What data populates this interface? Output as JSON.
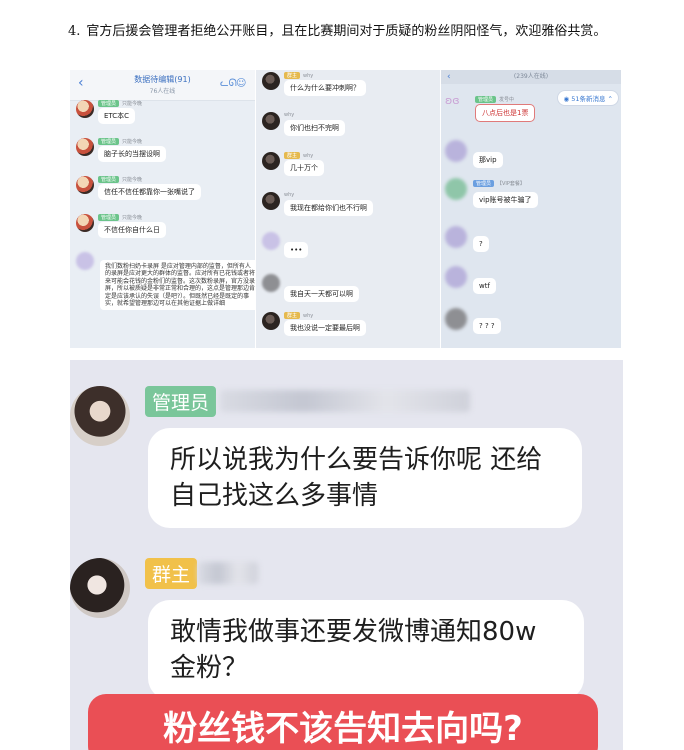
{
  "paragraph": {
    "number": "4.",
    "text": "官方后援会管理者拒绝公开账目，且在比赛期间对于质疑的粉丝阴阳怪气，欢迎雅俗共赏。"
  },
  "panel1": {
    "title": "数据待编辑(91)",
    "subtitle": "76人在线",
    "back_icon": "‹",
    "messages": [
      {
        "tag": "管理员",
        "name": "只能今晚",
        "text": "ETC本C"
      },
      {
        "tag": "管理员",
        "name": "只能今晚",
        "text": "脑子长的当摆设啊"
      },
      {
        "tag": "管理员",
        "name": "只能今晚",
        "text": "信任不信任都靠你一张嘴说了"
      },
      {
        "tag": "管理员",
        "name": "只能今晚",
        "text": "不信任你自什么日"
      }
    ],
    "long_text": "我们数粉扫奶卡录屏 是应对管理内部的监督，但所有人的录屏是应对更大的群体的监督。应对所有已花钱或者将来可能会花钱的金粉们的监督。这次数粉录屏，官方没录屏，所以被质疑是非常正常和合理的，这点是管理那边肯定是应该承认的失误（是吧?）。但既然已经是既定的事实，就希望管理那边可以在其他证据上做详细"
  },
  "panel2": {
    "messages": [
      {
        "tag": "群主",
        "name": "why",
        "text": "什么为什么要冲刺啊？"
      },
      {
        "tag": "",
        "name": "why",
        "text": "你们也扫不完啊"
      },
      {
        "tag": "群主",
        "name": "why",
        "text": "几十万个"
      },
      {
        "tag": "",
        "name": "why",
        "text": "我现在都给你们也不行啊"
      },
      {
        "tag": "",
        "name": "",
        "text": "•••"
      },
      {
        "tag": "",
        "name": "",
        "text": "我自天一天都可以啊"
      },
      {
        "tag": "群主",
        "name": "why",
        "text": "我也没说一定要最后啊"
      }
    ]
  },
  "panel3": {
    "header": "(239人在线)",
    "new_messages": "51条新消息",
    "messages": [
      {
        "tag": "管理员",
        "name": "发号中",
        "text": "八点后也是1票"
      },
      {
        "tag": "",
        "name": "",
        "text": "那vip"
      },
      {
        "tag": "管理员",
        "name": "【VIP套餐】",
        "text": "vip账号被牛骗了"
      },
      {
        "tag": "",
        "name": "",
        "text": "?"
      },
      {
        "tag": "",
        "name": "",
        "text": "wtf"
      },
      {
        "tag": "",
        "name": "",
        "text": "? ? ?"
      }
    ]
  },
  "big_chat": {
    "msg1": {
      "tag": "管理员",
      "text_line1": "所以说我为什么要告诉你呢 还给",
      "text_line2": "自己找这么多事情"
    },
    "msg2": {
      "tag": "群主",
      "text_line1": "敢情我做事还要发微博通知80w",
      "text_line2": "金粉？"
    },
    "caption": "粉丝钱不该告知去向吗?"
  },
  "colors": {
    "admin_tag": "#7ac69a",
    "owner_tag": "#f1c14a",
    "caption_red": "#ea4f55",
    "chat_bg": "#e5e6ef"
  }
}
